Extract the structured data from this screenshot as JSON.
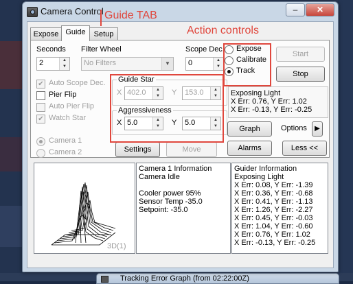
{
  "window": {
    "title": "Camera Control",
    "caption_buttons": {
      "minimize": "–",
      "maximize": "□",
      "close": "✕"
    }
  },
  "annotations": {
    "guide_tab": "Guide TAB",
    "action_controls": "Action controls"
  },
  "tabs": [
    {
      "label": "Expose",
      "active": false
    },
    {
      "label": "Guide",
      "active": true
    },
    {
      "label": "Setup",
      "active": false
    }
  ],
  "guide_tab": {
    "seconds_label": "Seconds",
    "seconds_value": "2",
    "filter_wheel_label": "Filter Wheel",
    "filter_wheel_value": "No Filters",
    "scope_dec_label": "Scope Dec.",
    "scope_dec_value": "0",
    "checkboxes": [
      {
        "label": "Auto Scope Dec.",
        "checked": true,
        "enabled": false
      },
      {
        "label": "Pier Flip",
        "checked": false,
        "enabled": true
      },
      {
        "label": "Auto Pier Flip",
        "checked": false,
        "enabled": false
      },
      {
        "label": "Watch Star",
        "checked": true,
        "enabled": false
      }
    ],
    "camera_radios": [
      {
        "label": "Camera 1",
        "selected": true
      },
      {
        "label": "Camera 2",
        "selected": false
      }
    ],
    "guide_star": {
      "title": "Guide Star",
      "x_label": "X",
      "x_value": "402.0",
      "y_label": "Y",
      "y_value": "153.0"
    },
    "aggressiveness": {
      "title": "Aggressiveness",
      "x_label": "X",
      "x_value": "5.0",
      "y_label": "Y",
      "y_value": "5.0"
    },
    "settings_button": "Settings",
    "move_button": "Move",
    "alarms_button": "Alarms",
    "less_button": "Less <<"
  },
  "actions": {
    "modes": [
      {
        "label": "Expose",
        "selected": false
      },
      {
        "label": "Calibrate",
        "selected": false
      },
      {
        "label": "Track",
        "selected": true
      }
    ],
    "start_button": "Start",
    "stop_button": "Stop",
    "status_lines": [
      "Exposing Light",
      "X Err: 0.76, Y Err: 1.02",
      "X Err: -0.13, Y Err: -0.25"
    ],
    "graph_button": "Graph",
    "options_label": "Options",
    "options_arrow": "▶"
  },
  "profile": {
    "label": "3D(1)"
  },
  "camera_info": {
    "lines": [
      "Camera 1 Information",
      "Camera Idle",
      "",
      "Cooler power 95%",
      "Sensor Temp -35.0",
      "Setpoint: -35.0"
    ]
  },
  "guider_info": {
    "lines": [
      "Guider Information",
      "Exposing Light",
      "X Err: 0.08, Y Err: -1.39",
      "X Err: 0.36, Y Err: -0.68",
      "X Err: 0.41, Y Err: -1.13",
      "X Err: 1.26, Y Err: -2.27",
      "X Err: 0.45, Y Err: -0.03",
      "X Err: 1.04, Y Err: -0.60",
      "X Err: 0.76, Y Err: 1.02",
      "X Err: -0.13, Y Err: -0.25"
    ]
  },
  "background_window": {
    "title": "Tracking Error Graph (from 02:22:00Z)"
  },
  "colors": {
    "annotation": "#e0473d",
    "title_bar": "#c9d7e6",
    "client": "#f0f0f0",
    "close_button": "#c8453a"
  }
}
